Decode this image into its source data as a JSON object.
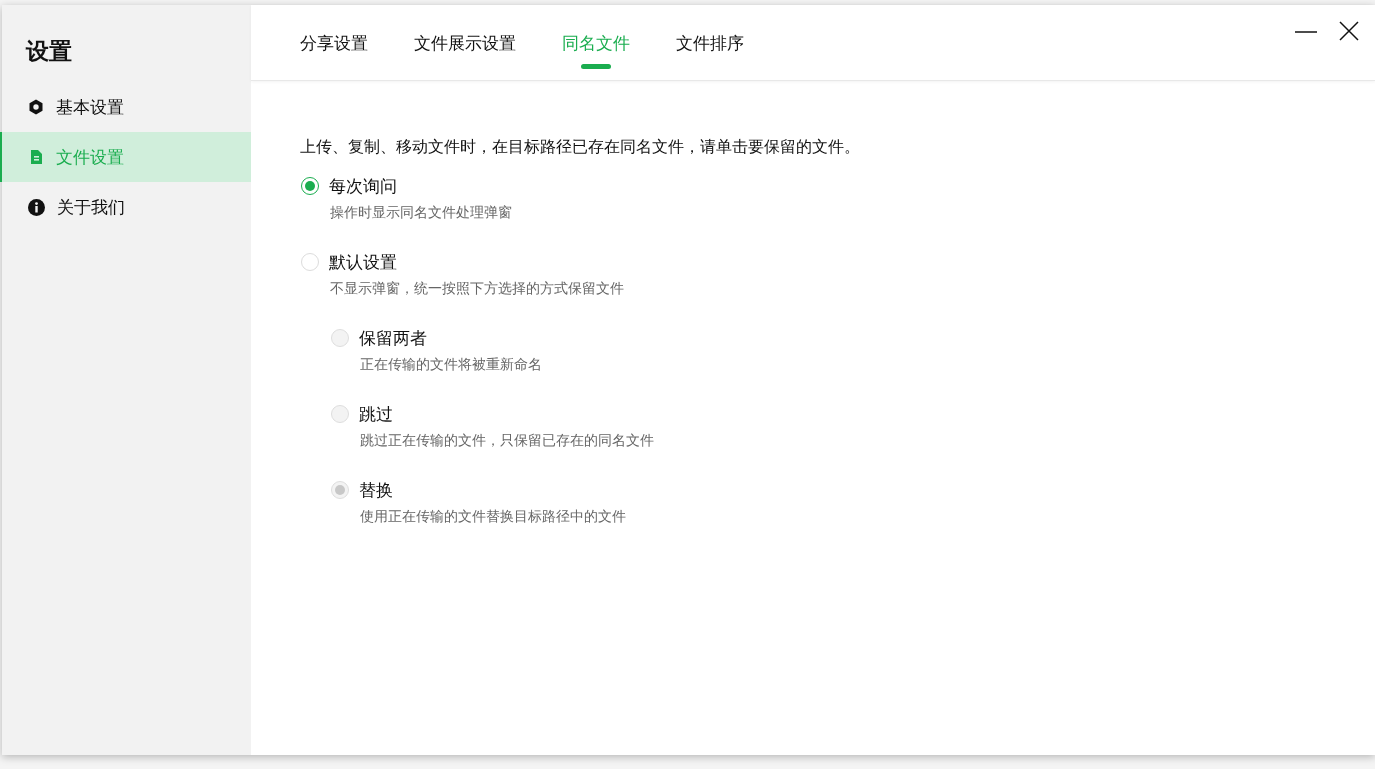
{
  "sidebar": {
    "title": "设置",
    "items": [
      {
        "label": "基本设置",
        "kind": "hexagon",
        "selected": false
      },
      {
        "label": "文件设置",
        "kind": "document",
        "selected": true
      },
      {
        "label": "关于我们",
        "kind": "info",
        "selected": false
      }
    ]
  },
  "tabs": [
    {
      "label": "分享设置",
      "selected": false
    },
    {
      "label": "文件展示设置",
      "selected": false
    },
    {
      "label": "同名文件",
      "selected": true
    },
    {
      "label": "文件排序",
      "selected": false
    }
  ],
  "description": "上传、复制、移动文件时，在目标路径已存在同名文件，请单击要保留的文件。",
  "options": [
    {
      "label": "每次询问",
      "hint": "操作时显示同名文件处理弹窗",
      "selected": true,
      "disabled": false
    },
    {
      "label": "默认设置",
      "hint": "不显示弹窗，统一按照下方选择的方式保留文件",
      "selected": false,
      "disabled": false,
      "children": [
        {
          "label": "保留两者",
          "hint": "正在传输的文件将被重新命名",
          "selected": false,
          "disabled": true
        },
        {
          "label": "跳过",
          "hint": "跳过正在传输的文件，只保留已存在的同名文件",
          "selected": false,
          "disabled": true
        },
        {
          "label": "替换",
          "hint": "使用正在传输的文件替换目标路径中的文件",
          "selected": true,
          "disabled": true
        }
      ]
    }
  ]
}
